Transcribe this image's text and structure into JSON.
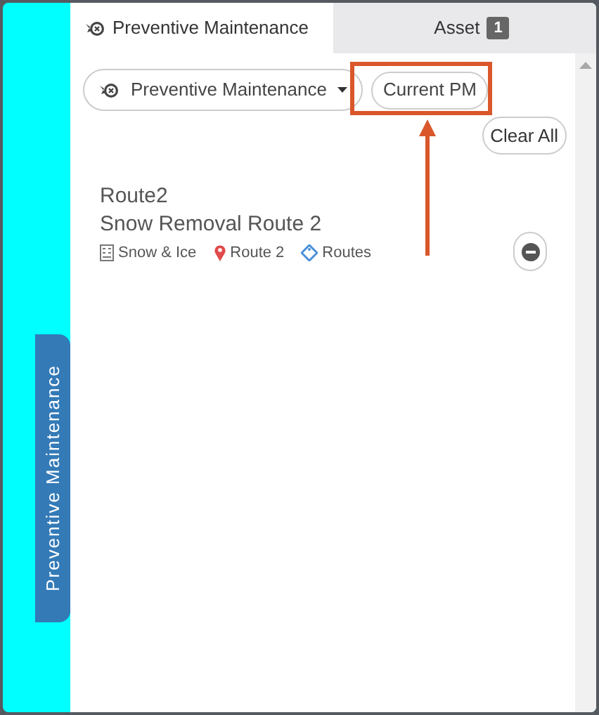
{
  "side_tab": {
    "label": "Preventive Maintenance"
  },
  "tabs": [
    {
      "label": "Preventive Maintenance",
      "selected": true,
      "icon": true
    },
    {
      "label": "Asset",
      "selected": false,
      "badge": "1"
    }
  ],
  "filter": {
    "label": "Preventive Maintenance"
  },
  "current_pm_button": "Current PM",
  "clear_all_button": "Clear All",
  "items": [
    {
      "title": "Route2",
      "subtitle": "Snow Removal Route 2",
      "tags": [
        {
          "kind": "building",
          "text": "Snow & Ice"
        },
        {
          "kind": "pin",
          "text": "Route 2"
        },
        {
          "kind": "tag",
          "text": "Routes"
        }
      ]
    }
  ]
}
